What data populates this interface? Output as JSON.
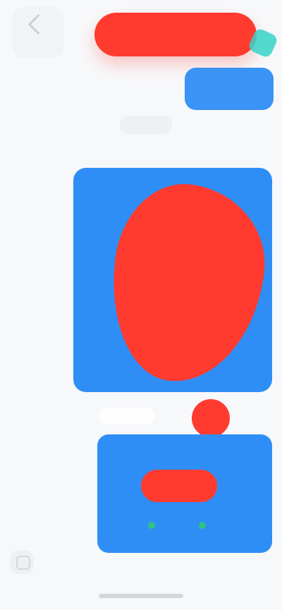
{
  "header": {
    "back_label": "",
    "title": "",
    "right_chip_icon": "teal-chip-icon"
  },
  "timeline": {
    "time_label": ""
  },
  "messages": {
    "card_1": {
      "text": ""
    },
    "card_2": {
      "text": ""
    }
  },
  "colors": {
    "primary_blue": "#2f8ef5",
    "redaction_red": "#ff3b30",
    "teal": "#37d3c8",
    "status_green": "#2ecc71",
    "background": "#f7f8fa"
  },
  "icons": {
    "back": "chevron-left-icon",
    "bottom_left": "tool-icon",
    "home": "home-indicator"
  }
}
